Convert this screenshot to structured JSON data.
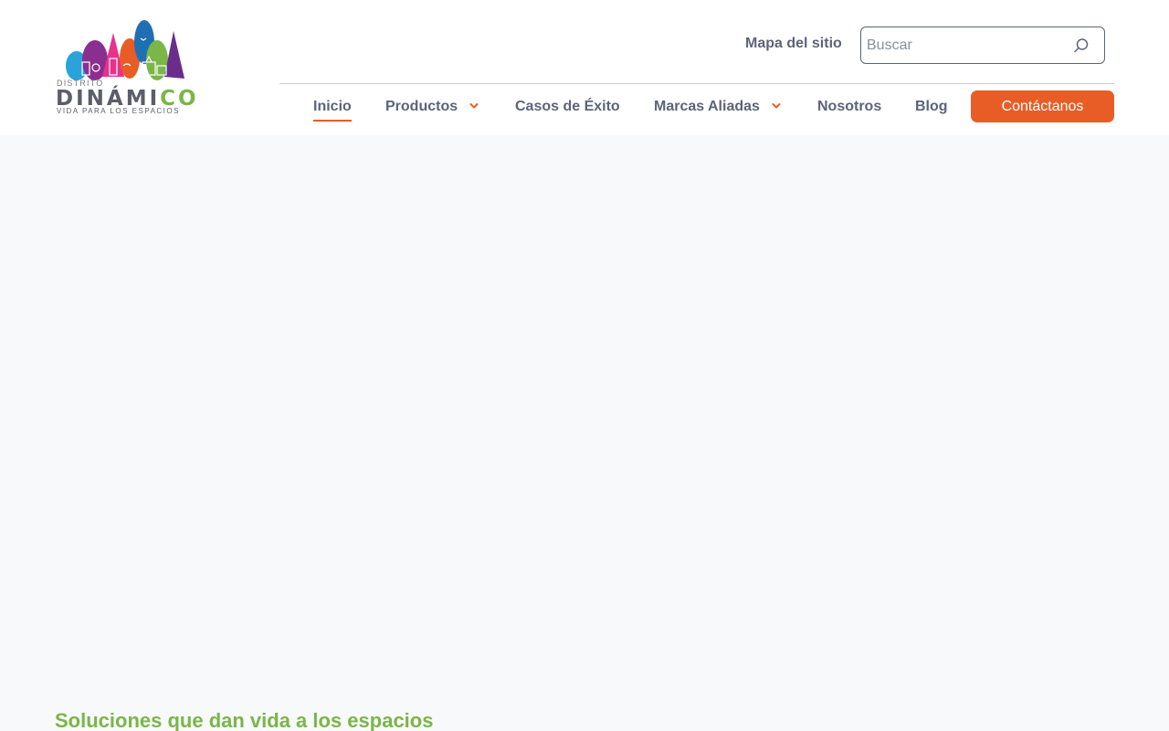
{
  "logo": {
    "small_text": "DISTRITO",
    "big_dark": "DINÁMI",
    "big_green": "CO",
    "tagline": "VIDA PARA LOS ESPACIOS"
  },
  "header": {
    "sitemap_label": "Mapa del sitio",
    "search_placeholder": "Buscar",
    "search_value": ""
  },
  "nav": {
    "items": [
      {
        "label": "Inicio",
        "active": true
      },
      {
        "label": "Productos",
        "dropdown": true
      },
      {
        "label": "Casos de Éxito"
      },
      {
        "label": "Marcas Aliadas",
        "dropdown": true
      },
      {
        "label": "Nosotros"
      },
      {
        "label": "Blog"
      }
    ],
    "cta_label": "Contáctanos"
  },
  "main": {
    "section_title": "Soluciones que dan vida a los espacios"
  },
  "colors": {
    "accent": "#e85d26",
    "brand_green": "#7ab648",
    "nav_text": "#5b6478"
  }
}
